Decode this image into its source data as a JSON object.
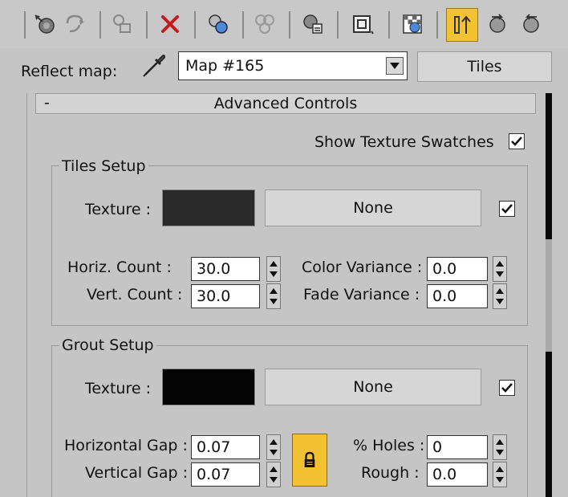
{
  "toolbar": {
    "icons": [
      "get-material-icon",
      "put-to-scene-icon",
      "assign-to-selection-icon",
      "delete-map-icon",
      "make-unique-icon",
      "put-to-library-icon",
      "material-id-channel-icon",
      "show-in-viewport-icon",
      "show-background-icon",
      "show-end-result-icon",
      "go-to-parent-icon",
      "go-forward-icon"
    ],
    "active_icon": "show-end-result-icon"
  },
  "reflect_map": {
    "label": "Reflect map:",
    "value": "Map #165",
    "type_button": "Tiles"
  },
  "rollout": {
    "collapse_symbol": "-",
    "title": "Advanced Controls",
    "show_swatches_label": "Show Texture Swatches",
    "show_swatches_checked": true
  },
  "tiles_setup": {
    "title": "Tiles Setup",
    "texture_label": "Texture :",
    "texture_color": "#2a2a2a",
    "map_button": "None",
    "enabled": true,
    "horiz_count_label": "Horiz. Count :",
    "horiz_count": "30.0",
    "vert_count_label": "Vert. Count :",
    "vert_count": "30.0",
    "color_variance_label": "Color Variance :",
    "color_variance": "0.0",
    "fade_variance_label": "Fade Variance :",
    "fade_variance": "0.0"
  },
  "grout_setup": {
    "title": "Grout Setup",
    "texture_label": "Texture :",
    "texture_color": "#050505",
    "map_button": "None",
    "enabled": true,
    "horizontal_gap_label": "Horizontal Gap :",
    "horizontal_gap": "0.07",
    "vertical_gap_label": "Vertical Gap :",
    "vertical_gap": "0.07",
    "holes_label": "% Holes :",
    "holes": "0",
    "rough_label": "Rough :",
    "rough": "0.0",
    "gap_lock": true
  },
  "colors": {
    "accent": "#f3c233",
    "panel": "#c5c5c5"
  }
}
